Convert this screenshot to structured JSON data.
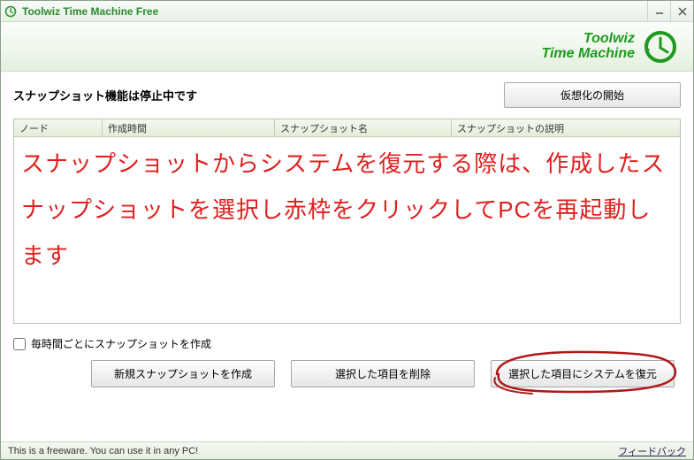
{
  "window": {
    "title": "Toolwiz Time Machine Free"
  },
  "brand": {
    "line1": "Toolwiz",
    "line2": "Time Machine"
  },
  "status": {
    "text": "スナップショット機能は停止中です",
    "start_button": "仮想化の開始"
  },
  "table": {
    "columns": {
      "node": "ノード",
      "created": "作成時間",
      "name": "スナップショット名",
      "desc": "スナップショットの説明"
    }
  },
  "annotation": {
    "text": "スナップショットからシステムを復元する際は、作成したスナップショットを選択し赤枠をクリックしてPCを再起動します"
  },
  "checkbox": {
    "label": "毎時間ごとにスナップショットを作成"
  },
  "buttons": {
    "create": "新規スナップショットを作成",
    "delete": "選択した項目を削除",
    "restore": "選択した項目にシステムを復元"
  },
  "footer": {
    "freeware": "This is a freeware. You can use it in any PC!",
    "feedback": "フィードバック"
  }
}
